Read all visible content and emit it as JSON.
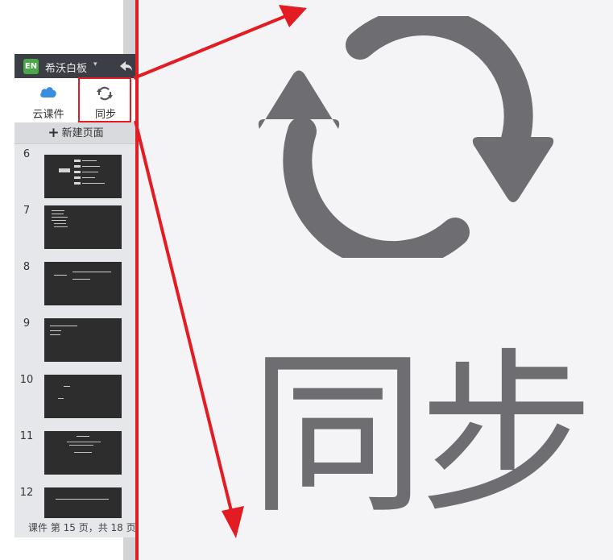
{
  "app": {
    "logo": "EN",
    "name": "希沃白板",
    "caret": "▾"
  },
  "toolbar": {
    "cloud_label": "云课件",
    "sync_label": "同步"
  },
  "new_page_label": "新建页面",
  "slides": [
    {
      "number": "6"
    },
    {
      "number": "7"
    },
    {
      "number": "8"
    },
    {
      "number": "9"
    },
    {
      "number": "10"
    },
    {
      "number": "11"
    },
    {
      "number": "12"
    }
  ],
  "status_text": "课件 第 15 页，共 18 页",
  "zoom": {
    "label": "同步"
  },
  "colors": {
    "annotation": "#e31b23",
    "cloud": "#3a8ee0",
    "sync_icon": "#6e6d72",
    "logo": "#4aa84a"
  },
  "icons": {
    "undo": "undo-icon",
    "cloud": "cloud-icon",
    "sync": "sync-icon",
    "add": "plus-icon"
  }
}
